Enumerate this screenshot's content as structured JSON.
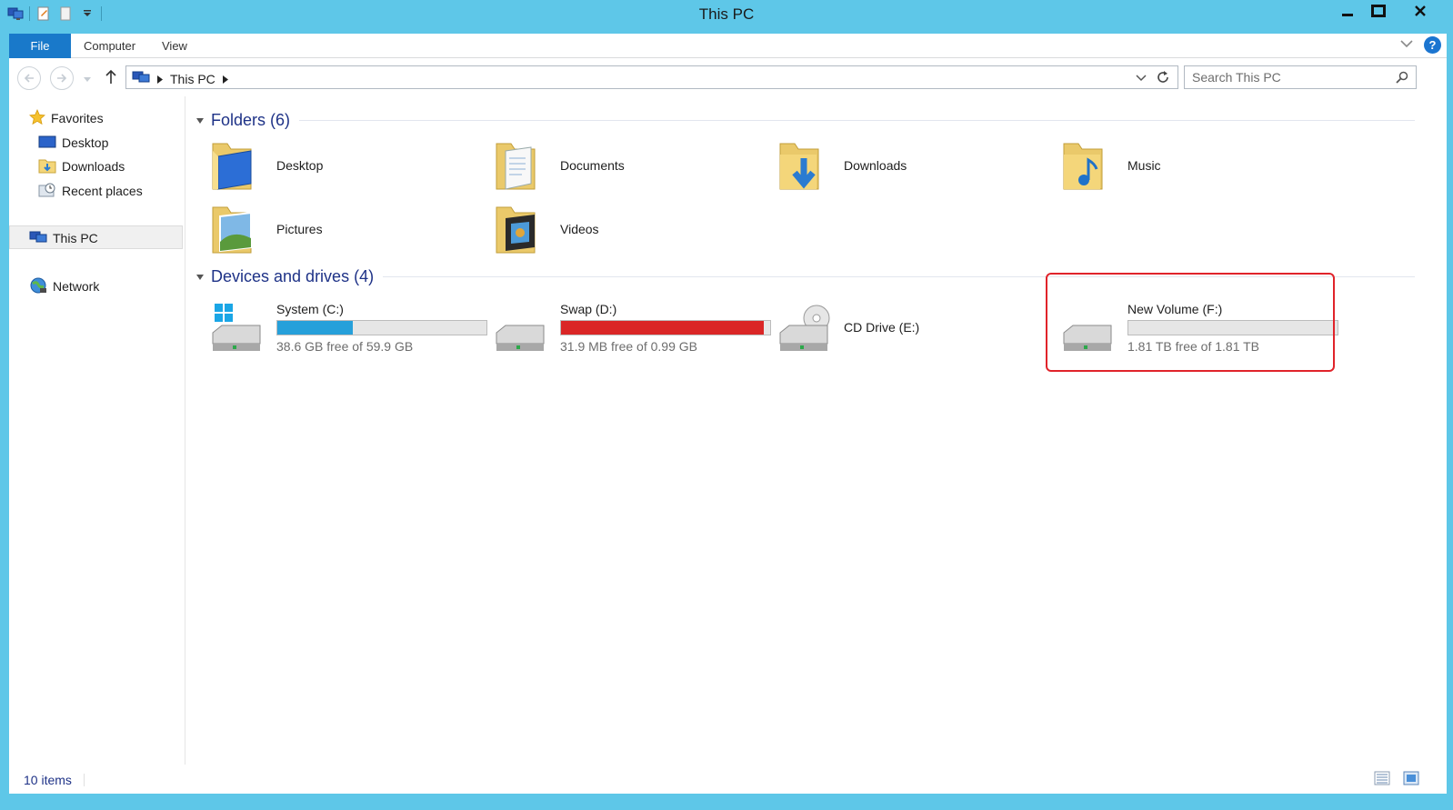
{
  "window": {
    "title": "This PC"
  },
  "ribbon": {
    "tabs": [
      {
        "label": "File"
      },
      {
        "label": "Computer"
      },
      {
        "label": "View"
      }
    ]
  },
  "address": {
    "crumb": "This PC"
  },
  "search": {
    "placeholder": "Search This PC"
  },
  "sidebar": {
    "favorites": "Favorites",
    "desktop": "Desktop",
    "downloads": "Downloads",
    "recent": "Recent places",
    "thispc": "This PC",
    "network": "Network"
  },
  "folders": {
    "header": "Folders (6)",
    "items": [
      {
        "label": "Desktop",
        "icon": "folder-desktop-icon"
      },
      {
        "label": "Documents",
        "icon": "folder-documents-icon"
      },
      {
        "label": "Downloads",
        "icon": "folder-downloads-icon"
      },
      {
        "label": "Music",
        "icon": "folder-music-icon"
      },
      {
        "label": "Pictures",
        "icon": "folder-pictures-icon"
      },
      {
        "label": "Videos",
        "icon": "folder-videos-icon"
      }
    ]
  },
  "drives": {
    "header": "Devices and drives (4)",
    "items": [
      {
        "label": "System (C:)",
        "free": "38.6 GB free of 59.9 GB",
        "used_fraction": 0.36,
        "bar_color": "#26a0da"
      },
      {
        "label": "Swap (D:)",
        "free": "31.9 MB free of 0.99 GB",
        "used_fraction": 0.97,
        "bar_color": "#da2626"
      },
      {
        "label": "CD Drive (E:)"
      },
      {
        "label": "New Volume (F:)",
        "free": "1.81 TB free of 1.81 TB",
        "used_fraction": 0.0,
        "bar_color": "#26a0da"
      }
    ]
  },
  "status": {
    "items": "10 items"
  },
  "colors": {
    "accent": "#1979ca",
    "window_frame": "#5ec7e8",
    "highlight": "#e0232a"
  }
}
